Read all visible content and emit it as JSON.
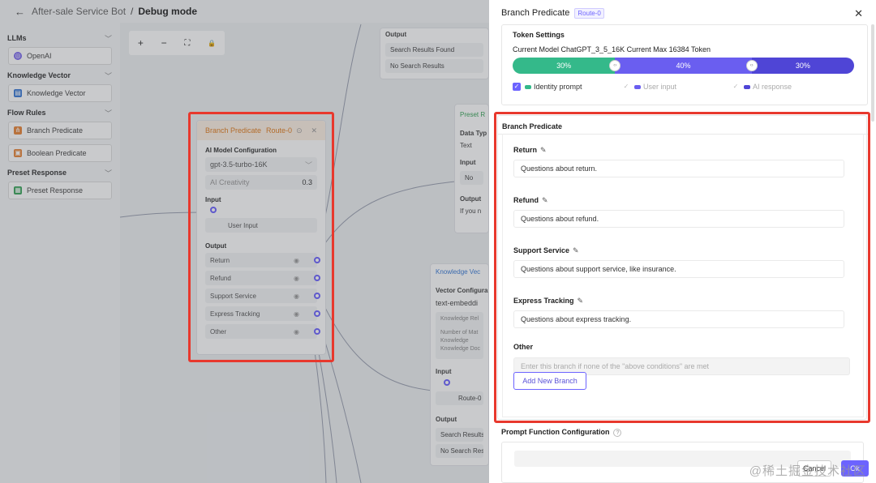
{
  "topbar": {
    "back_icon": "←",
    "app_name": "After-sale Service Bot",
    "separator": "/",
    "mode": "Debug mode"
  },
  "sidebar": {
    "groups": [
      {
        "label": "LLMs",
        "items": [
          {
            "label": "OpenAI",
            "icon_color": "#7b68ee"
          }
        ]
      },
      {
        "label": "Knowledge Vector",
        "items": [
          {
            "label": "Knowledge Vector",
            "icon_color": "#3b7bd6"
          }
        ]
      },
      {
        "label": "Flow Rules",
        "items": [
          {
            "label": "Branch Predicate",
            "icon_color": "#e8863a"
          },
          {
            "label": "Boolean Predicate",
            "icon_color": "#e8863a"
          }
        ]
      },
      {
        "label": "Preset Response",
        "items": [
          {
            "label": "Preset Response",
            "icon_color": "#3aa55a"
          }
        ]
      }
    ]
  },
  "zoom": {
    "zoom_in": "+",
    "zoom_out": "−",
    "fit": "⛶",
    "lock": "🔒"
  },
  "branch_node": {
    "title": "Branch Predicate",
    "route": "Route-0",
    "ai_model_label": "AI Model Configuration",
    "model": "gpt-3.5-turbo-16K",
    "creativity_label": "AI Creativity",
    "creativity_value": "0.3",
    "input_label": "Input",
    "input_item": "User Input",
    "output_label": "Output",
    "outputs": [
      "Return",
      "Refund",
      "Support Service",
      "Express Tracking",
      "Other"
    ]
  },
  "output_node": {
    "label": "Output",
    "rows": [
      "Search Results Found",
      "No Search Results"
    ]
  },
  "preset_node": {
    "title": "Preset R",
    "data_type_label": "Data Typ",
    "data_type": "Text",
    "input_label": "Input",
    "input_row": "No",
    "output_label": "Output",
    "output_row": "If you n"
  },
  "kv_node": {
    "title": "Knowledge Vec",
    "vector_config_label": "Vector Configura",
    "embedding": "text-embeddi",
    "box_lines": [
      "Knowledge Rel",
      "Number of Mat",
      "Knowledge",
      "Knowledge Doc"
    ],
    "input_label": "Input",
    "input_row": "Route-0",
    "output_label": "Output",
    "outputs": [
      "Search Results",
      "No Search Res"
    ]
  },
  "drawer": {
    "title": "Branch Predicate",
    "route_tag": "Route-0",
    "close_icon": "✕",
    "token": {
      "title": "Token Settings",
      "model_text": "Current Model ChatGPT_3_5_16K Current Max 16384 Token",
      "segments": [
        {
          "label": "30%",
          "value": 30,
          "color": "#34b98a"
        },
        {
          "label": "40%",
          "value": 40,
          "color": "#6a5ef0"
        },
        {
          "label": "30%",
          "value": 30,
          "color": "#4f45d6"
        }
      ],
      "legend": [
        {
          "label": "Identity prompt",
          "checked": true,
          "disabled": false,
          "color": "#34b98a"
        },
        {
          "label": "User input",
          "checked": true,
          "disabled": true,
          "color": "#6a5ef0"
        },
        {
          "label": "AI response",
          "checked": true,
          "disabled": true,
          "color": "#4f45d6"
        }
      ]
    },
    "branch": {
      "title": "Branch Predicate",
      "items": [
        {
          "label": "Return",
          "value": "Questions about return."
        },
        {
          "label": "Refund",
          "value": "Questions about refund."
        },
        {
          "label": "Support Service",
          "value": "Questions about support service, like insurance."
        },
        {
          "label": "Express Tracking",
          "value": "Questions about express tracking."
        }
      ],
      "other_label": "Other",
      "other_placeholder": "Enter this branch if none of the \"above conditions\" are met",
      "add_button": "Add New Branch"
    },
    "prompt_function": {
      "title": "Prompt Function Configuration",
      "help_icon": "?"
    },
    "cancel": "Cancel",
    "ok": "Ok"
  },
  "watermark": "@稀土掘金技术社区"
}
